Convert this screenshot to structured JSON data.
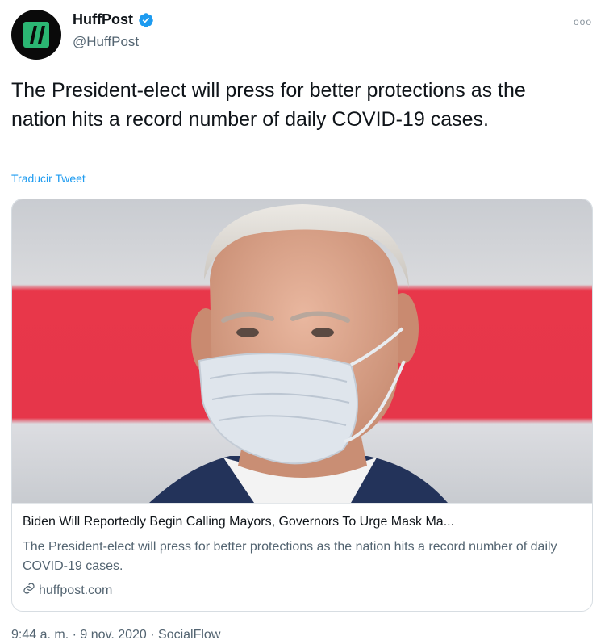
{
  "tweet": {
    "author_name": "HuffPost",
    "author_handle": "@HuffPost",
    "more_label": "ooo",
    "text": "The President-elect will press for better protections as the nation hits a record number of daily COVID-19 cases.",
    "translate_label": "Traducir Tweet"
  },
  "card": {
    "title": "Biden Will Reportedly Begin Calling Mayors, Governors To Urge Mask Ma...",
    "description": "The President-elect will press for better protections as the nation hits a record number of daily COVID-19 cases.",
    "domain": "huffpost.com",
    "link_icon": "link-icon"
  },
  "meta": {
    "line": "9:44 a. m. · 9 nov. 2020 · SocialFlow"
  },
  "colors": {
    "accent": "#1d9bf0",
    "avatar_bg": "#0a0a0a",
    "logo_green": "#2bb673"
  }
}
